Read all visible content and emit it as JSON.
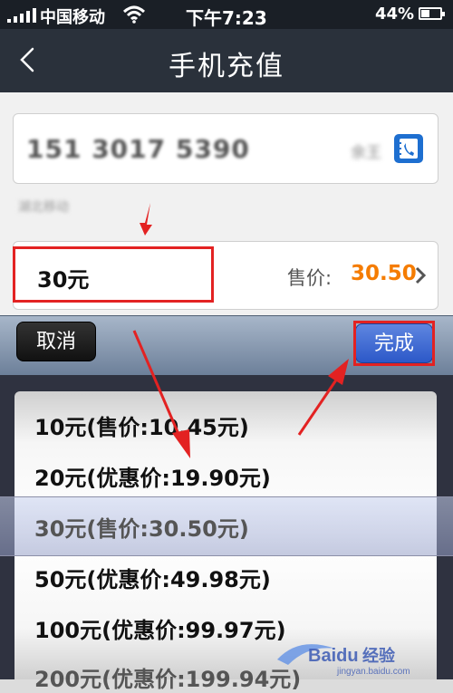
{
  "status_bar": {
    "carrier": "中国移动",
    "time": "下午7:23",
    "battery": "44%",
    "battery_level": 0.44,
    "signal_bars": 5
  },
  "nav": {
    "title": "手机充值",
    "back_icon": "chevron-left-icon"
  },
  "form": {
    "phone_number": "151 3017 5390",
    "owner_name": "余王",
    "carrier_line": "湖北移动",
    "contact_icon": "contacts-book-icon",
    "amount": "30元",
    "price_label": "售价:",
    "price": "30.50",
    "price_color": "#f57c00",
    "chevron_icon": "chevron-right-icon"
  },
  "toolbar": {
    "cancel": "取消",
    "done": "完成"
  },
  "picker": {
    "options": [
      "10元(售价:10.45元)",
      "20元(优惠价:19.90元)",
      "30元(售价:30.50元)",
      "50元(优惠价:49.98元)",
      "100元(优惠价:99.97元)",
      "200元(优惠价:199.94元)"
    ],
    "selected": "30元(售价:30.50元)"
  },
  "annotation_color": "#e32222",
  "watermark": {
    "brand": "Baidu",
    "text": "经验",
    "url": "jingyan.baidu.com"
  }
}
